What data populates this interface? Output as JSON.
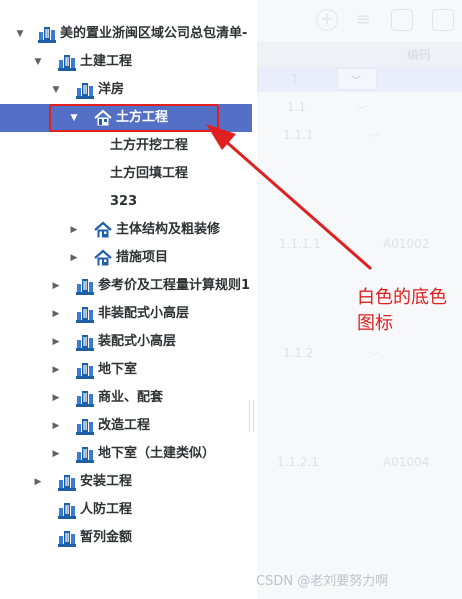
{
  "tree": {
    "nodes": [
      {
        "label": "美的置业浙闽区域公司总包清单-",
        "icon": "building-icon",
        "caret": "▼",
        "depth": 0
      },
      {
        "label": "土建工程",
        "icon": "building-icon",
        "caret": "▼",
        "depth": 1
      },
      {
        "label": "洋房",
        "icon": "building-icon",
        "caret": "▼",
        "depth": 2
      },
      {
        "label": "土方工程",
        "icon": "house-icon",
        "caret": "▼",
        "depth": 3,
        "selected": true
      },
      {
        "label": "土方开挖工程",
        "depth": 4
      },
      {
        "label": "土方回填工程",
        "depth": 4
      },
      {
        "label": "323",
        "depth": 4
      },
      {
        "label": "主体结构及粗装修",
        "icon": "house-icon",
        "caret": "▶",
        "depth": 3
      },
      {
        "label": "措施项目",
        "icon": "house-icon",
        "caret": "▶",
        "depth": 3
      },
      {
        "label": "参考价及工程量计算规则1",
        "icon": "building-icon",
        "caret": "▶",
        "depth": 2
      },
      {
        "label": "非装配式小高层",
        "icon": "building-icon",
        "caret": "▶",
        "depth": 2
      },
      {
        "label": "装配式小高层",
        "icon": "building-icon",
        "caret": "▶",
        "depth": 2
      },
      {
        "label": "地下室",
        "icon": "building-icon",
        "caret": "▶",
        "depth": 2
      },
      {
        "label": "商业、配套",
        "icon": "building-icon",
        "caret": "▶",
        "depth": 2
      },
      {
        "label": "改造工程",
        "icon": "building-icon",
        "caret": "▶",
        "depth": 2
      },
      {
        "label": "地下室（土建类似）",
        "icon": "building-icon",
        "caret": "▶",
        "depth": 2
      },
      {
        "label": "安装工程",
        "icon": "building-icon",
        "caret": "▶",
        "depth": 1
      },
      {
        "label": "人防工程",
        "icon": "building-icon",
        "depth": 1
      },
      {
        "label": "暂列金额",
        "icon": "building-icon",
        "depth": 1
      }
    ]
  },
  "table": {
    "header": "编码",
    "rows": [
      {
        "num": "1",
        "code": ""
      },
      {
        "num": "1.1",
        "code": ""
      },
      {
        "num": "1.1.1",
        "code": ""
      },
      {
        "num": "1.1.1.1",
        "code": "A01002"
      },
      {
        "num": "1.1.2",
        "code": ""
      },
      {
        "num": "1.1.2.1",
        "code": "A01004"
      }
    ]
  },
  "toolbar": {
    "add": "+",
    "indent": "≡",
    "delete": "🗑",
    "more": "▢"
  },
  "annotation": {
    "text": "白色的底色图标"
  },
  "watermark": "CSDN @老刘要努力啊",
  "colors": {
    "selected_bg": "#5470c6",
    "annotation_red": "#e02020",
    "icon_blue": "#1f5fa8"
  }
}
